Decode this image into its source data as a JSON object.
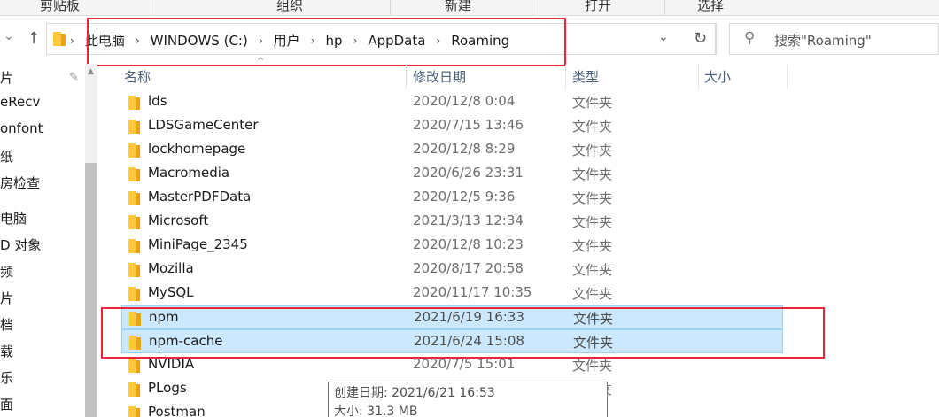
{
  "ribbon": {
    "groups": [
      "剪贴板",
      "组织",
      "新建",
      "打开",
      "选择"
    ]
  },
  "address": {
    "parts": [
      "此电脑",
      "WINDOWS (C:)",
      "用户",
      "hp",
      "AppData",
      "Roaming"
    ]
  },
  "search": {
    "placeholder": "搜索\"Roaming\""
  },
  "left_nav": {
    "items": [
      "片",
      "eRecv",
      "onfont",
      "纸",
      "房检查",
      "电脑",
      "D 对象",
      "频",
      "片",
      "档",
      "载",
      "乐",
      "面"
    ]
  },
  "columns": {
    "name": "名称",
    "date": "修改日期",
    "type": "类型",
    "size": "大小"
  },
  "files": [
    {
      "name": "lds",
      "date": "2020/12/8 0:04",
      "type": "文件夹"
    },
    {
      "name": "LDSGameCenter",
      "date": "2020/7/15 13:46",
      "type": "文件夹"
    },
    {
      "name": "lockhomepage",
      "date": "2020/12/8 8:29",
      "type": "文件夹"
    },
    {
      "name": "Macromedia",
      "date": "2020/6/26 23:31",
      "type": "文件夹"
    },
    {
      "name": "MasterPDFData",
      "date": "2020/12/5 9:36",
      "type": "文件夹"
    },
    {
      "name": "Microsoft",
      "date": "2021/3/13 12:34",
      "type": "文件夹"
    },
    {
      "name": "MiniPage_2345",
      "date": "2020/12/8 10:23",
      "type": "文件夹"
    },
    {
      "name": "Mozilla",
      "date": "2020/8/17 20:58",
      "type": "文件夹"
    },
    {
      "name": "MySQL",
      "date": "2020/11/17 10:35",
      "type": "文件夹"
    },
    {
      "name": "npm",
      "date": "2021/6/19 16:33",
      "type": "文件夹",
      "selected": true
    },
    {
      "name": "npm-cache",
      "date": "2021/6/24 15:08",
      "type": "文件夹",
      "selected": true
    },
    {
      "name": "NVIDIA",
      "date": "2020/7/5 15:01",
      "type": "文件夹"
    },
    {
      "name": "PLogs",
      "date": "",
      "type": "文件夹"
    },
    {
      "name": "Postman",
      "date": "",
      "type": ""
    }
  ],
  "tooltip": {
    "created": "创建日期: 2021/6/21 16:53",
    "size": "大小: 31.3 MB"
  },
  "colors": {
    "selection_bg": "#cce8ff",
    "selection_border": "#99d1ff",
    "highlight_box": "#e8283a",
    "folder": "#ffc83d"
  },
  "icons": [
    "up-arrow-icon",
    "folder-icon",
    "chevron-right-icon",
    "chevron-down-icon",
    "refresh-icon",
    "search-icon",
    "pin-icon"
  ]
}
